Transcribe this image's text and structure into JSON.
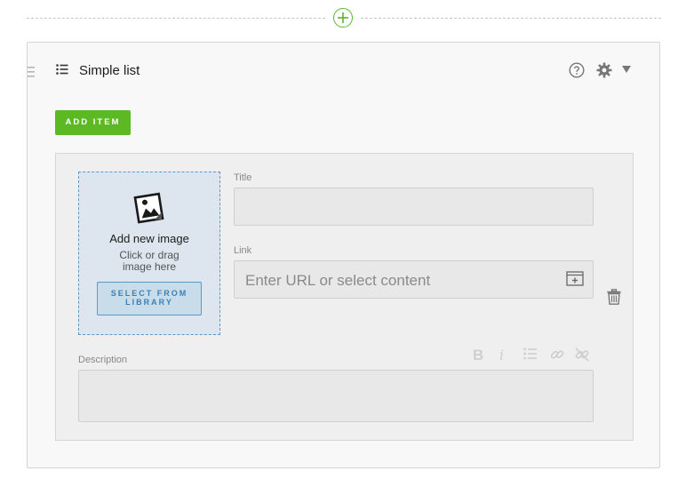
{
  "header": {
    "add_block_icon": "plus-circle-icon"
  },
  "block": {
    "title": "Simple list",
    "icons": [
      "drag-handle-icon",
      "list-icon",
      "help-icon",
      "gear-icon",
      "caret-down-icon"
    ],
    "add_item_label": "ADD ITEM"
  },
  "item": {
    "image": {
      "add_label": "Add new image",
      "hint_line1": "Click or drag",
      "hint_line2": "image here",
      "select_line1": "SELECT FROM",
      "select_line2": "LIBRARY"
    },
    "title_label": "Title",
    "title_value": "",
    "link_label": "Link",
    "link_placeholder": "Enter URL or select content",
    "description_label": "Description",
    "description_value": "",
    "toolbar": {
      "bold": "B",
      "italic": "i"
    }
  },
  "colors": {
    "accent_green": "#5cb823",
    "accent_blue": "#3a80b5"
  }
}
